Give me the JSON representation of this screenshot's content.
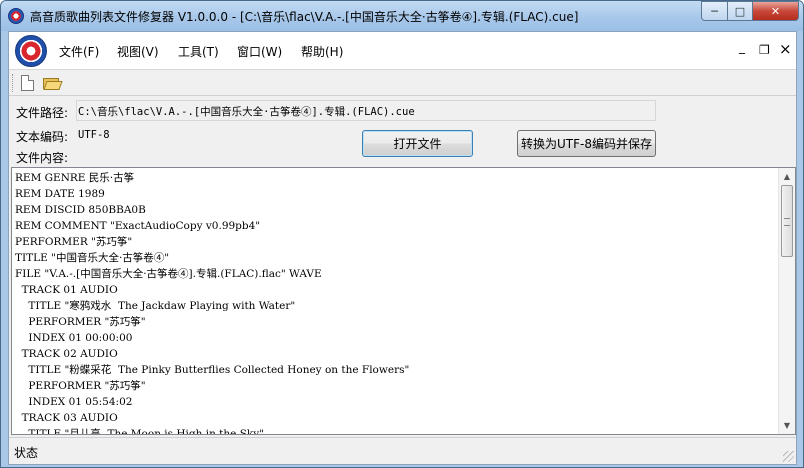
{
  "window": {
    "title": "高音质歌曲列表文件修复器 V1.0.0.0 - [C:\\音乐\\flac\\V.A.-.[中国音乐大全·古筝卷④].专辑.(FLAC).cue]",
    "minimize_glyph": "─",
    "maximize_glyph": "□",
    "close_glyph": "✕"
  },
  "menu": {
    "items": [
      {
        "label": "文件(F)"
      },
      {
        "label": "视图(V)"
      },
      {
        "label": "工具(T)"
      },
      {
        "label": "窗口(W)"
      },
      {
        "label": "帮助(H)"
      }
    ],
    "mdi_minimize": "_",
    "mdi_restore": "❐",
    "mdi_close": "×"
  },
  "toolbar": {
    "buttons": [
      {
        "icon": "new-file-icon"
      },
      {
        "icon": "open-folder-icon"
      }
    ]
  },
  "form": {
    "path_label": "文件路径:",
    "path_value": "C:\\音乐\\flac\\V.A.-.[中国音乐大全·古筝卷④].专辑.(FLAC).cue",
    "encoding_label": "文本编码:",
    "encoding_value": "UTF-8",
    "content_label": "文件内容:",
    "open_button": "打开文件",
    "convert_button": "转换为UTF-8编码并保存"
  },
  "content": {
    "lines": [
      "REM GENRE 民乐·古筝",
      "REM DATE 1989",
      "REM DISCID 850BBA0B",
      "REM COMMENT \"ExactAudioCopy v0.99pb4\"",
      "PERFORMER \"苏巧筝\"",
      "TITLE \"中国音乐大全·古筝卷④\"",
      "FILE \"V.A.-.[中国音乐大全·古筝卷④].专辑.(FLAC).flac\" WAVE",
      "  TRACK 01 AUDIO",
      "    TITLE \"寒鸦戏水  The Jackdaw Playing with Water\"",
      "    PERFORMER \"苏巧筝\"",
      "    INDEX 01 00:00:00",
      "  TRACK 02 AUDIO",
      "    TITLE \"粉蝶采花  The Pinky Butterflies Collected Honey on the Flowers\"",
      "    PERFORMER \"苏巧筝\"",
      "    INDEX 01 05:54:02",
      "  TRACK 03 AUDIO",
      "    TITLE \"月儿高  The Moon is High in the Sky\""
    ]
  },
  "statusbar": {
    "text": "状态"
  }
}
